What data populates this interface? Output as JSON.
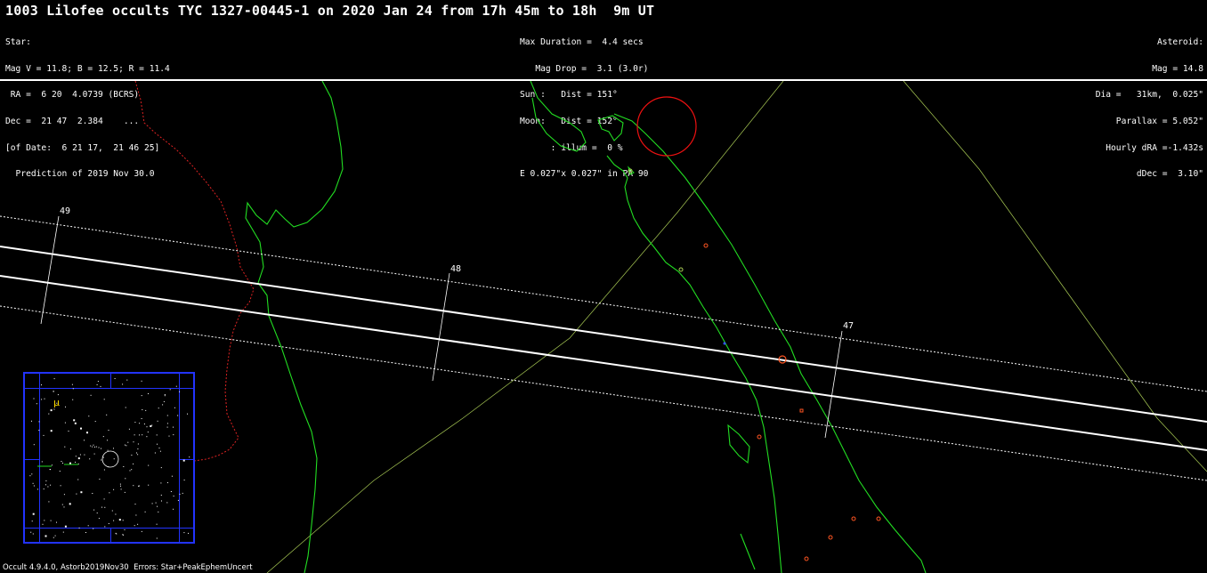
{
  "title": "1003 Lilofee occults TYC 1327-00445-1 on 2020 Jan 24 from 17h 45m to 18h  9m UT",
  "star": {
    "lines": [
      "Star:",
      "Mag V = 11.8; B = 12.5; R = 11.4",
      " RA =  6 20  4.0739 (BCRS)",
      "Dec =  21 47  2.384    ...",
      "[of Date:  6 21 17,  21 46 25]",
      "  Prediction of 2019 Nov 30.0"
    ]
  },
  "event": {
    "lines": [
      "Max Duration =  4.4 secs",
      "   Mag Drop =  3.1 (3.0r)",
      "Sun :   Dist = 151°",
      "Moon:   Dist = 152°",
      "      : illum =  0 %",
      "E 0.027\"x 0.027\" in PA 90"
    ]
  },
  "asteroid": {
    "lines": [
      "Asteroid:",
      "Mag = 14.8",
      "Dia =   31km,  0.025\"",
      "Parallax = 5.052\"",
      "Hourly dRA =-1.432s",
      "dDec =  3.10\""
    ]
  },
  "map": {
    "time_ticks": [
      {
        "label": "49"
      },
      {
        "label": "48"
      },
      {
        "label": "47"
      }
    ],
    "colors": {
      "background": "#000000",
      "coastline": "#22dd22",
      "path_center": "#ffffff",
      "path_limits": "#ffffff",
      "border": "#dd2222",
      "graticule": "#aacc55",
      "sites": "#ff5522",
      "sun_circle": "#ee1111"
    }
  },
  "starchart": {
    "label": "μ",
    "frame_color": "#2233ff"
  },
  "footer": "Occult 4.9.4.0, Astorb2019Nov30  Errors: Star+PeakEphemUncert"
}
